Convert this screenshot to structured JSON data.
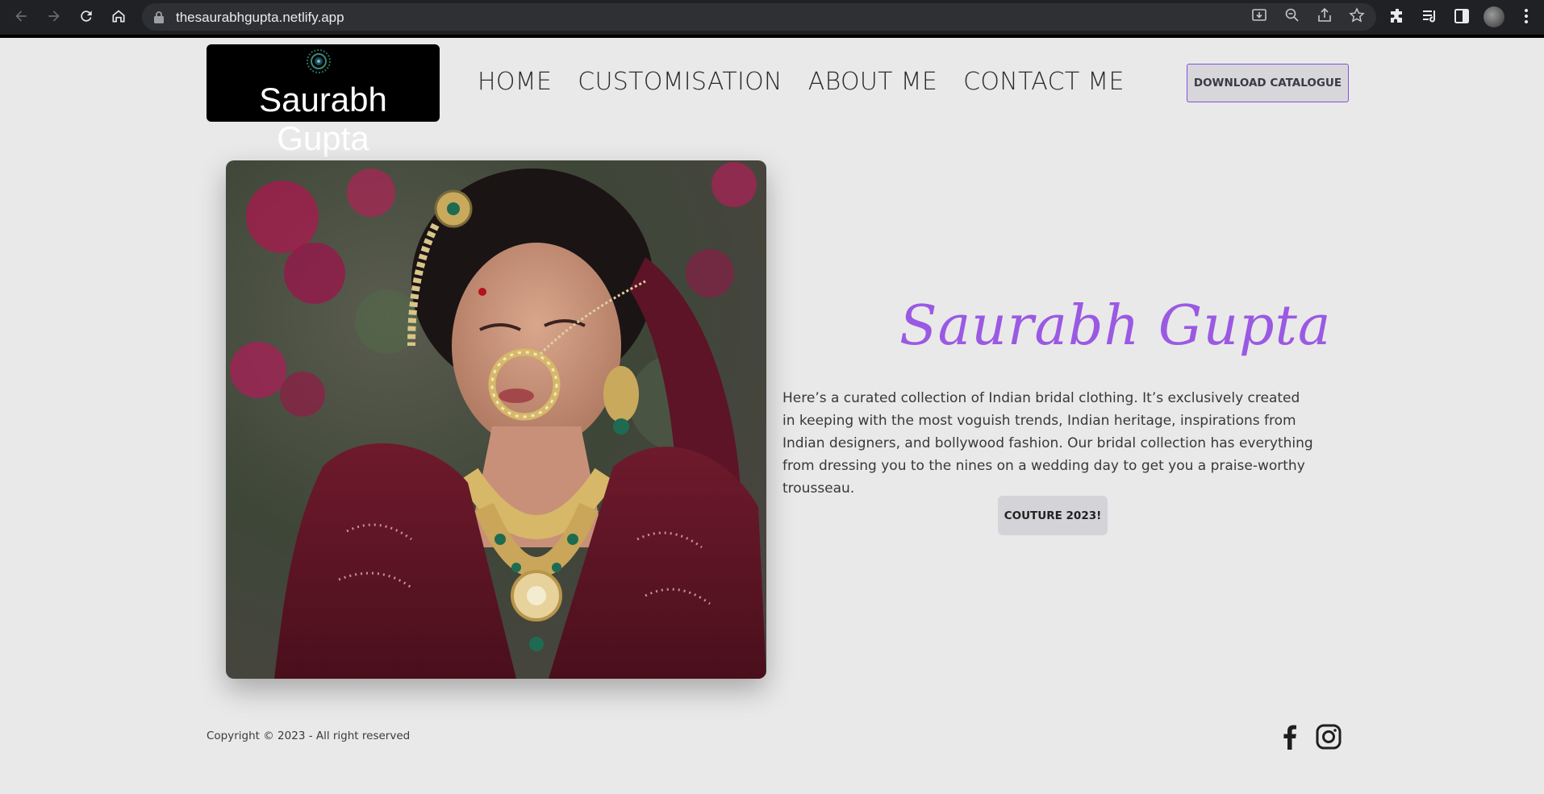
{
  "browser": {
    "url": "thesaurabhgupta.netlify.app",
    "icons": [
      "back-icon",
      "forward-icon",
      "reload-icon",
      "home-icon",
      "lock-icon",
      "install-icon",
      "zoom-out-icon",
      "share-icon",
      "star-icon",
      "extensions-icon",
      "reading-list-icon",
      "side-panel-icon",
      "profile-avatar",
      "menu-icon"
    ]
  },
  "header": {
    "logo_text": "Saurabh Gupta",
    "nav": [
      "HOME",
      "CUSTOMISATION",
      "ABOUT ME",
      "CONTACT ME"
    ],
    "download_label": "DOWNLOAD CATALOGUE"
  },
  "hero": {
    "title": "Saurabh Gupta",
    "description": "Here’s a curated collection of Indian bridal clothing. It’s exclusively created in keeping with the most voguish trends, Indian heritage, inspirations from Indian designers, and bollywood fashion. Our bridal collection has everything from dressing you to the nines on a wedding day to get you a praise-worthy trousseau.",
    "button_label": "COUTURE 2023!"
  },
  "footer": {
    "copyright": "Copyright © 2023 - All right reserved",
    "social": [
      "facebook-icon",
      "instagram-icon"
    ]
  },
  "colors": {
    "page_bg": "#e9e9e9",
    "accent_purple": "#9b59e3",
    "chrome_bg": "#202124"
  }
}
